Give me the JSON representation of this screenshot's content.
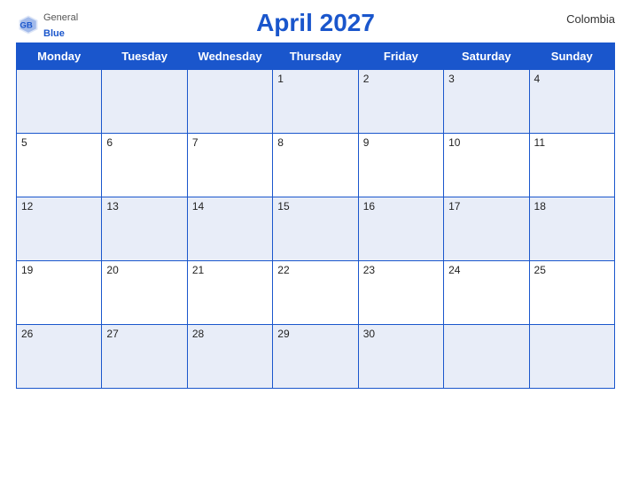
{
  "header": {
    "title": "April 2027",
    "country": "Colombia",
    "logo": {
      "general": "General",
      "blue": "Blue"
    }
  },
  "weekdays": [
    "Monday",
    "Tuesday",
    "Wednesday",
    "Thursday",
    "Friday",
    "Saturday",
    "Sunday"
  ],
  "weeks": [
    [
      null,
      null,
      null,
      1,
      2,
      3,
      4
    ],
    [
      5,
      6,
      7,
      8,
      9,
      10,
      11
    ],
    [
      12,
      13,
      14,
      15,
      16,
      17,
      18
    ],
    [
      19,
      20,
      21,
      22,
      23,
      24,
      25
    ],
    [
      26,
      27,
      28,
      29,
      30,
      null,
      null
    ]
  ]
}
